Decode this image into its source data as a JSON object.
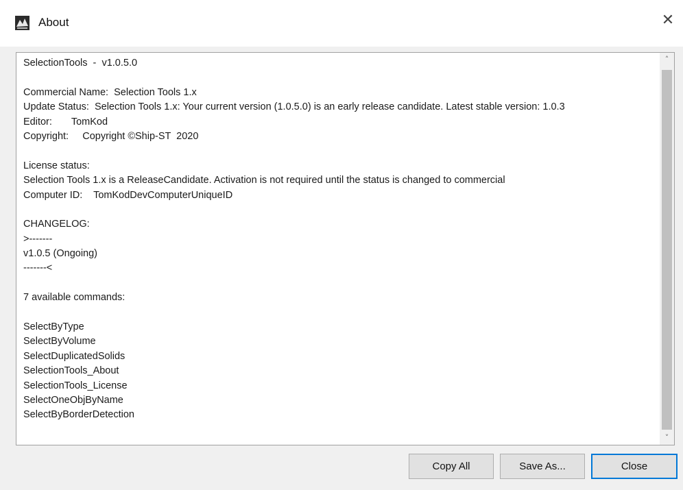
{
  "window": {
    "title": "About",
    "close_symbol": "✕",
    "icon_name": "app-logo-icon",
    "accent_color": "#0078d7"
  },
  "content": {
    "lines": [
      "SelectionTools  -  v1.0.5.0",
      "",
      "Commercial Name:  Selection Tools 1.x",
      "Update Status:  Selection Tools 1.x: Your current version (1.0.5.0) is an early release candidate. Latest stable version: 1.0.3",
      "Editor:       TomKod",
      "Copyright:     Copyright ©Ship-ST  2020",
      "",
      "License status:",
      "Selection Tools 1.x is a ReleaseCandidate. Activation is not required until the status is changed to commercial",
      "Computer ID:    TomKodDevComputerUniqueID",
      "",
      "CHANGELOG:",
      ">-------",
      "v1.0.5 (Ongoing)",
      "-------<",
      "",
      "7 available commands:",
      "",
      "SelectByType",
      "SelectByVolume",
      "SelectDuplicatedSolids",
      "SelectionTools_About",
      "SelectionTools_License",
      "SelectOneObjByName",
      "SelectByBorderDetection"
    ]
  },
  "scrollbar": {
    "up_symbol": "˄",
    "down_symbol": "˅"
  },
  "buttons": {
    "copy_all": "Copy All",
    "save_as": "Save As...",
    "close": "Close"
  }
}
